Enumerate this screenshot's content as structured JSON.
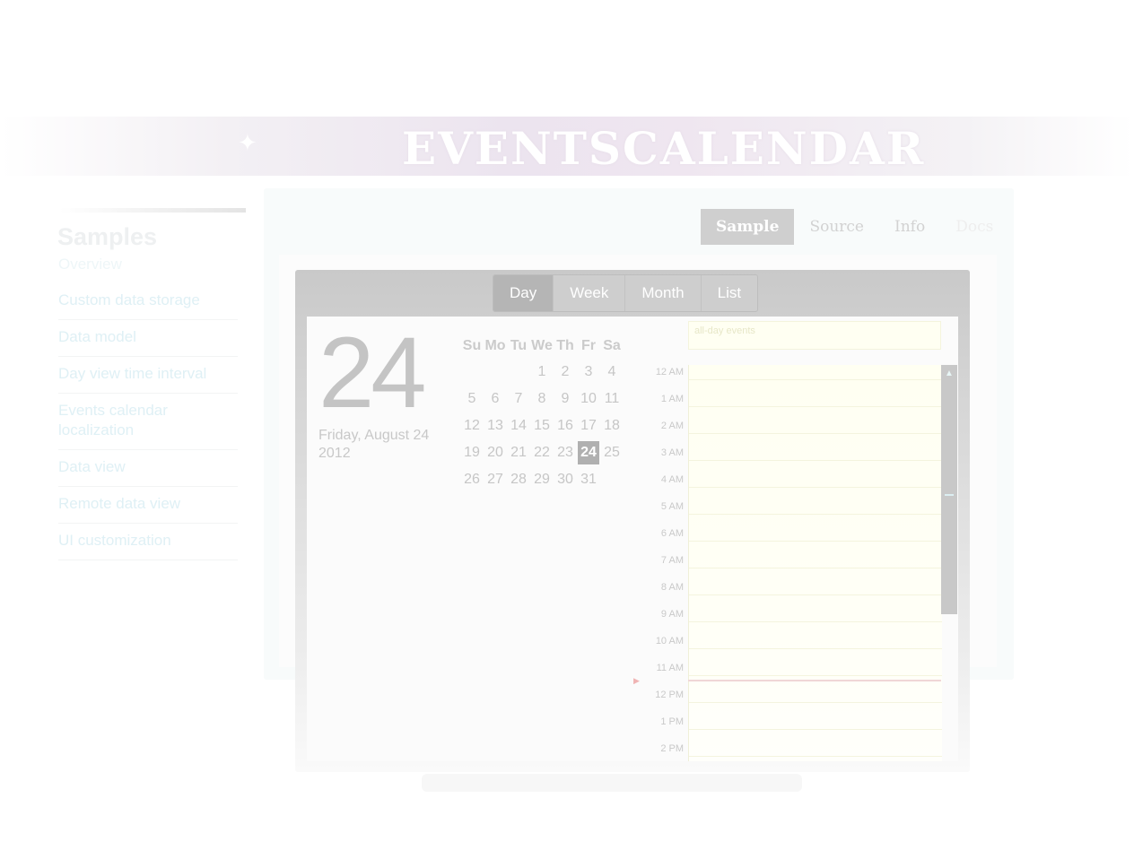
{
  "header": {
    "title": "EVENTSCALENDAR"
  },
  "sidebar": {
    "heading": "Samples",
    "items": [
      {
        "label": "Overview"
      },
      {
        "label": "Custom data storage"
      },
      {
        "label": "Data model"
      },
      {
        "label": "Day view time interval"
      },
      {
        "label": "Events calendar localization"
      },
      {
        "label": "Data view"
      },
      {
        "label": "Remote data view"
      },
      {
        "label": "UI customization"
      }
    ]
  },
  "tabs": [
    {
      "label": "Sample",
      "active": true
    },
    {
      "label": "Source"
    },
    {
      "label": "Info"
    },
    {
      "label": "Docs"
    }
  ],
  "views": [
    {
      "label": "Day",
      "active": true
    },
    {
      "label": "Week"
    },
    {
      "label": "Month"
    },
    {
      "label": "List"
    }
  ],
  "selected_date": {
    "day": "24",
    "line1": "Friday, August 24",
    "line2": "2012"
  },
  "mini_calendar": {
    "weekdays": [
      "Su",
      "Mo",
      "Tu",
      "We",
      "Th",
      "Fr",
      "Sa"
    ],
    "weeks": [
      [
        "",
        "",
        "",
        "1",
        "2",
        "3",
        "4"
      ],
      [
        "5",
        "6",
        "7",
        "8",
        "9",
        "10",
        "11"
      ],
      [
        "12",
        "13",
        "14",
        "15",
        "16",
        "17",
        "18"
      ],
      [
        "19",
        "20",
        "21",
        "22",
        "23",
        "24",
        "25"
      ],
      [
        "26",
        "27",
        "28",
        "29",
        "30",
        "31",
        ""
      ]
    ],
    "today": "24"
  },
  "schedule": {
    "all_day_label": "all-day events",
    "hours": [
      "12 AM",
      "1 AM",
      "2 AM",
      "3 AM",
      "4 AM",
      "5 AM",
      "6 AM",
      "7 AM",
      "8 AM",
      "9 AM",
      "10 AM",
      "11 AM",
      "12 PM",
      "1 PM",
      "2 PM"
    ]
  },
  "colors": {
    "accent": "#b0b0b0",
    "event_area": "#fffff2",
    "now_line": "#f0d6d6"
  }
}
